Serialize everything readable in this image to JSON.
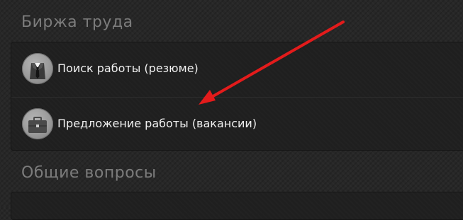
{
  "sections": [
    {
      "title": "Биржа труда",
      "items": [
        {
          "label": "Поиск работы (резюме)",
          "icon": "suit-tie-icon"
        },
        {
          "label": "Предложение работы (вакансии)",
          "icon": "briefcase-icon"
        }
      ]
    },
    {
      "title": "Общие вопросы",
      "items": []
    }
  ],
  "annotation": {
    "arrow_color": "#e31b1b"
  }
}
